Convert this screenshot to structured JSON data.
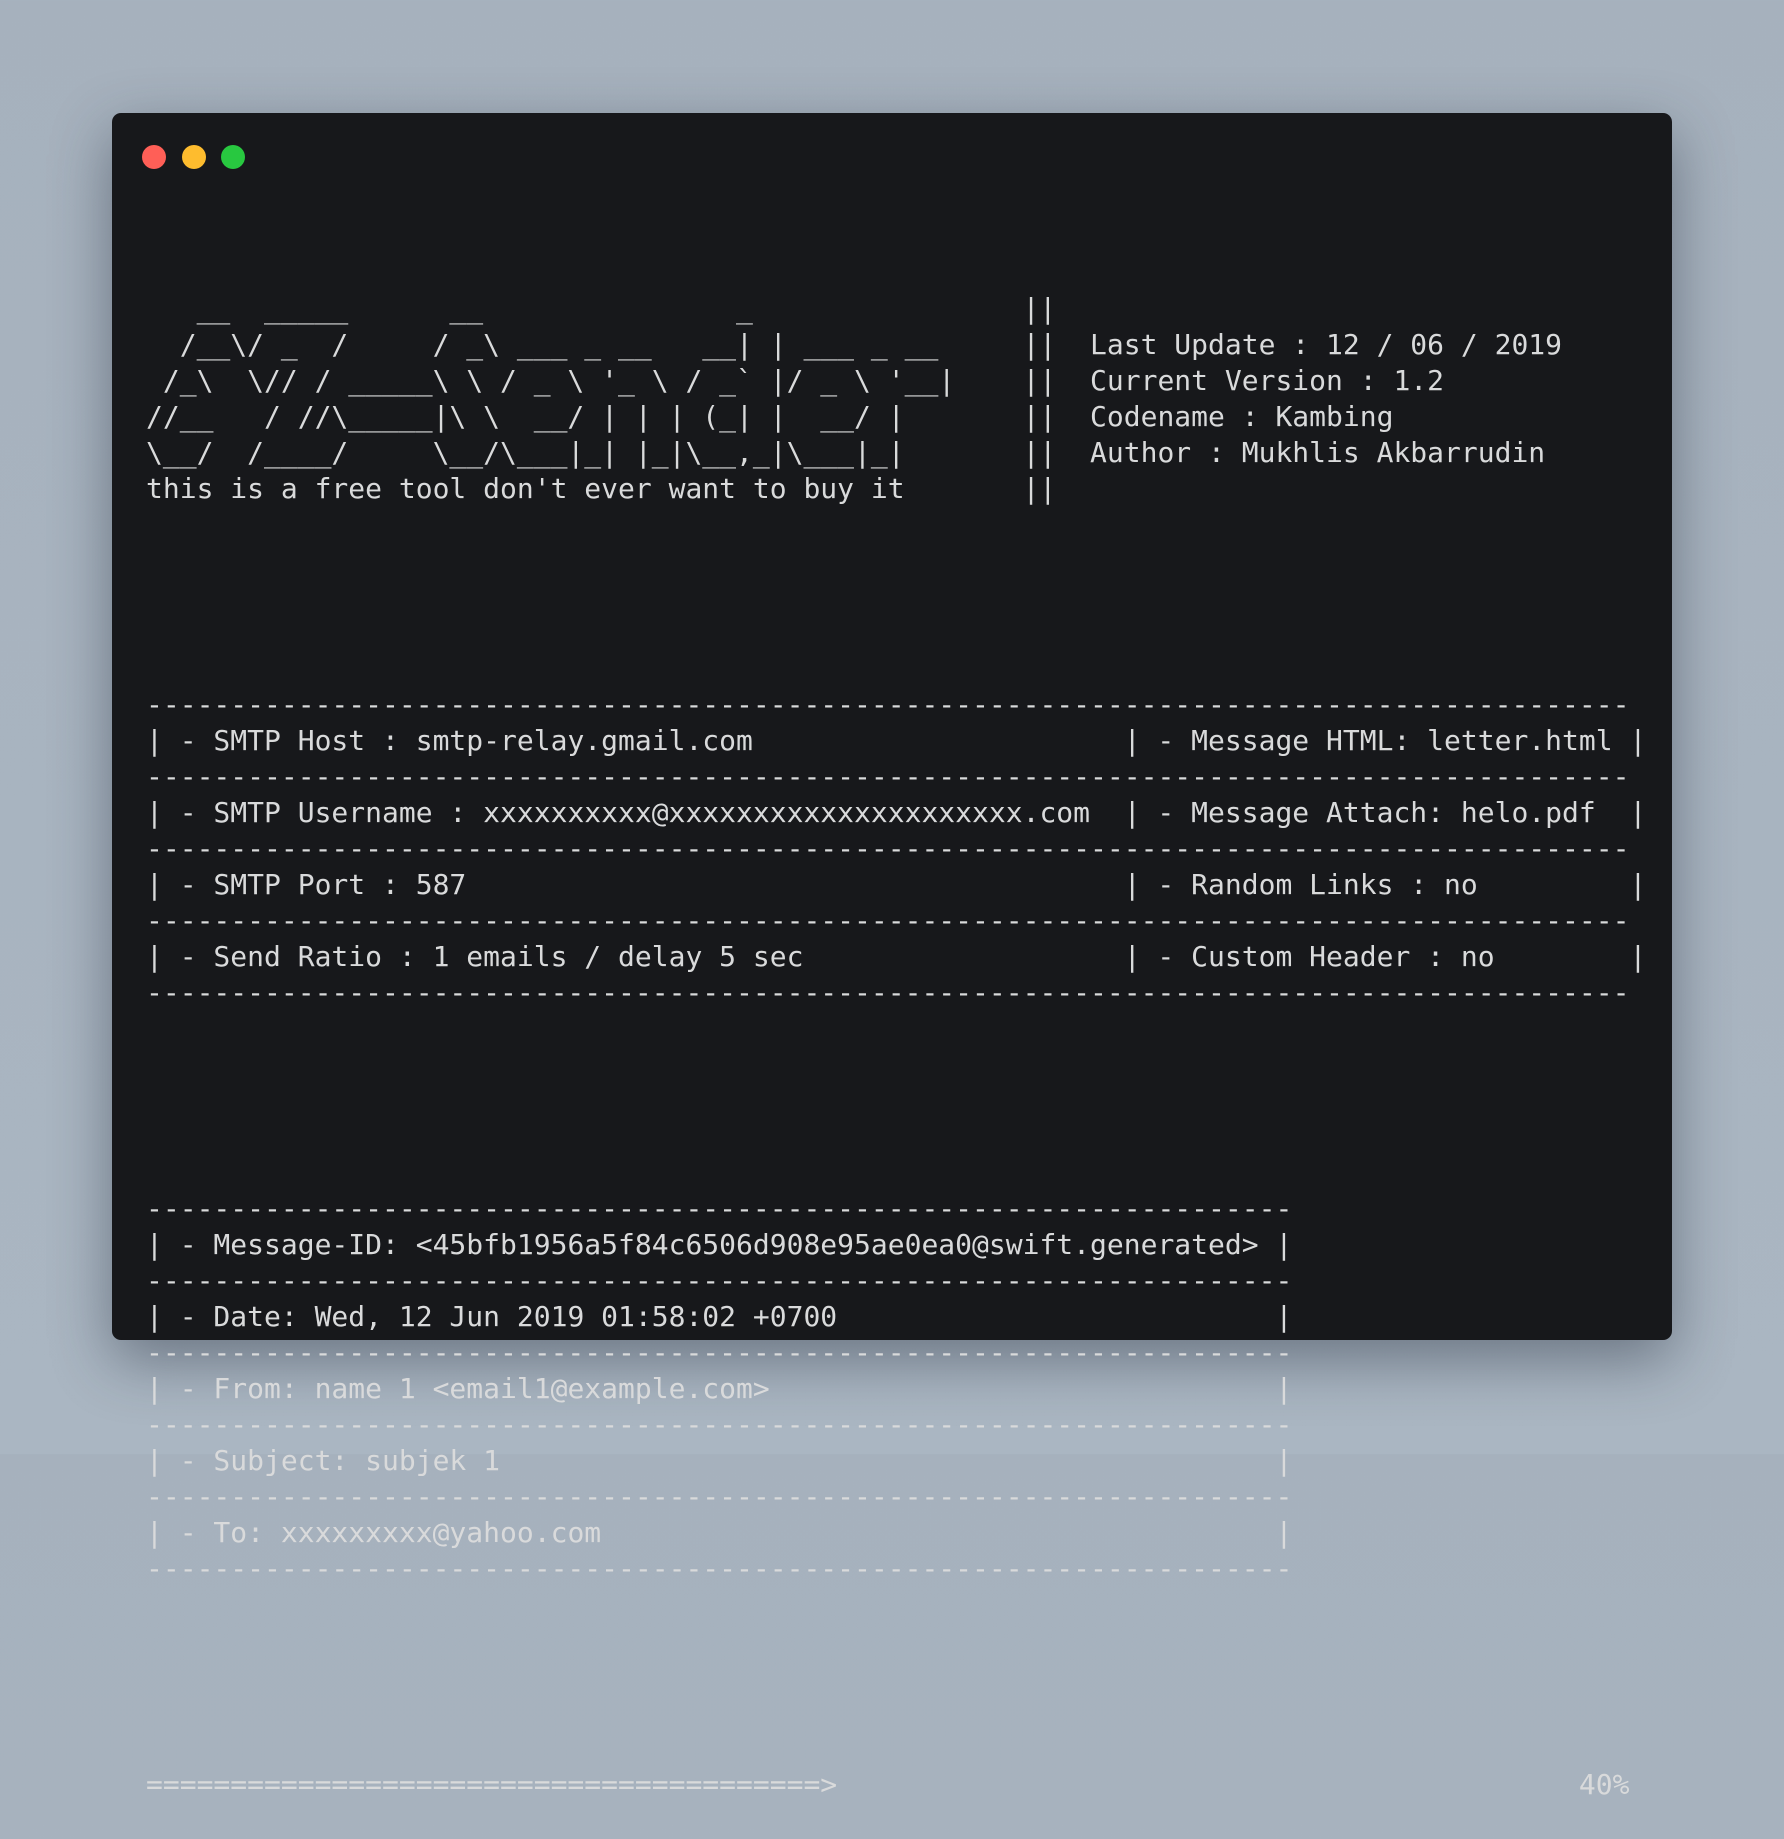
{
  "window": {
    "controls": {
      "close_color": "#ff5f57",
      "minimize_color": "#febc2e",
      "maximize_color": "#28c840"
    }
  },
  "banner": {
    "art": [
      "   __  _____      __               _",
      "  /__\\/ _  /     / _\\ ___ _ __   __| | ___ _ __",
      " /_\\  \\// / _____\\ \\ / _ \\ '_ \\ / _` |/ _ \\ '__|",
      "//__   / //\\_____|\\ \\  __/ | | | (_| |  __/ |",
      "\\__/  /____/     \\__/\\___|_| |_|\\__,_|\\___|_|",
      "this is a free tool don't ever want to buy it"
    ],
    "separator": "||",
    "info": [
      "",
      "Last Update : 12 / 06 / 2019",
      "Current Version : 1.2",
      "Codename : Kambing",
      "Author : Mukhlis Akbarrudin",
      ""
    ]
  },
  "config_table": {
    "rows": [
      {
        "left": " - SMTP Host : smtp-relay.gmail.com",
        "right": " - Message HTML: letter.html"
      },
      {
        "left": " - SMTP Username : xxxxxxxxxx@xxxxxxxxxxxxxxxxxxxxx.com",
        "right": " - Message Attach: helo.pdf"
      },
      {
        "left": " - SMTP Port : 587",
        "right": " - Random Links : no"
      },
      {
        "left": " - Send Ratio : 1 emails / delay 5 sec",
        "right": " - Custom Header : no"
      }
    ]
  },
  "message_table": {
    "rows": [
      " - Message-ID: <45bfb1956a5f84c6506d908e95ae0ea0@swift.generated>",
      " - Date: Wed, 12 Jun 2019 01:58:02 +0700",
      " - From: name 1 <email1@example.com>",
      " - Subject: subjek 1",
      " - To: xxxxxxxxx@yahoo.com"
    ]
  },
  "progress": {
    "percent": 40,
    "label": "40%"
  }
}
